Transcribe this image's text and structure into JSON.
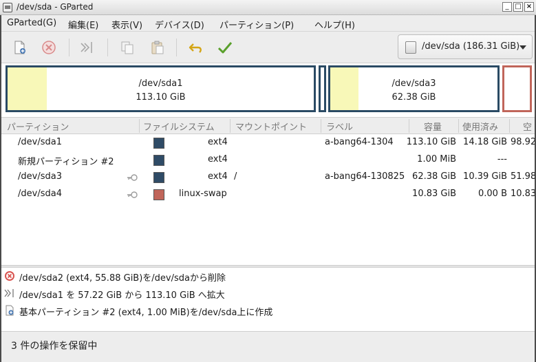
{
  "window": {
    "title": "/dev/sda - GParted"
  },
  "menu": [
    {
      "label": "GParted(G)"
    },
    {
      "label": "編集(E)"
    },
    {
      "label": "表示(V)"
    },
    {
      "label": "デバイス(D)"
    },
    {
      "label": "パーティション(P)"
    },
    {
      "label": "ヘルプ(H)"
    }
  ],
  "toolbar": {
    "icons": [
      "new-partition-icon",
      "delete-icon",
      "resize-move-icon",
      "copy-icon",
      "paste-icon",
      "undo-icon",
      "apply-icon"
    ],
    "device": "/dev/sda (186.31 GiB)"
  },
  "disk_map": {
    "partitions": [
      {
        "name": "/dev/sda1",
        "size": "113.10 GiB",
        "border": "#2a4a64"
      },
      {
        "name": "",
        "size": "",
        "border": "#2a4a64"
      },
      {
        "name": "/dev/sda3",
        "size": "62.38 GiB",
        "border": "#2a4a64"
      },
      {
        "name": "",
        "size": "",
        "border": "#c0655a"
      }
    ]
  },
  "table": {
    "headers": [
      "パーティション",
      "ファイルシステム",
      "マウントポイント",
      "ラベル",
      "容量",
      "使用済み",
      "空"
    ],
    "rows": [
      {
        "partition": "/dev/sda1",
        "key": false,
        "color": "#2f4b66",
        "fs": "ext4",
        "mount": "",
        "label": "a-bang64-1304",
        "size": "113.10 GiB",
        "used": "14.18 GiB",
        "free": "98.92"
      },
      {
        "partition": "新規パーティション #2",
        "key": false,
        "color": "#2f4b66",
        "fs": "ext4",
        "mount": "",
        "label": "",
        "size": "1.00 MiB",
        "used": "---",
        "free": ""
      },
      {
        "partition": "/dev/sda3",
        "key": true,
        "color": "#2f4b66",
        "fs": "ext4",
        "mount": "/",
        "label": "a-bang64-130825",
        "size": "62.38 GiB",
        "used": "10.39 GiB",
        "free": "51.98"
      },
      {
        "partition": "/dev/sda4",
        "key": true,
        "color": "#c0655a",
        "fs": "linux-swap",
        "mount": "",
        "label": "",
        "size": "10.83 GiB",
        "used": "0.00 B",
        "free": "10.83"
      }
    ]
  },
  "operations": [
    {
      "icon": "delete-icon",
      "text": "/dev/sda2 (ext4, 55.88 GiB)を/dev/sdaから削除"
    },
    {
      "icon": "resize-icon",
      "text": "/dev/sda1 を 57.22 GiB から 113.10 GiB へ拡大"
    },
    {
      "icon": "new-partition-icon",
      "text": "基本パーティション #2 (ext4, 1.00 MiB)を/dev/sda上に作成"
    }
  ],
  "status": "3 件の操作を保留中"
}
